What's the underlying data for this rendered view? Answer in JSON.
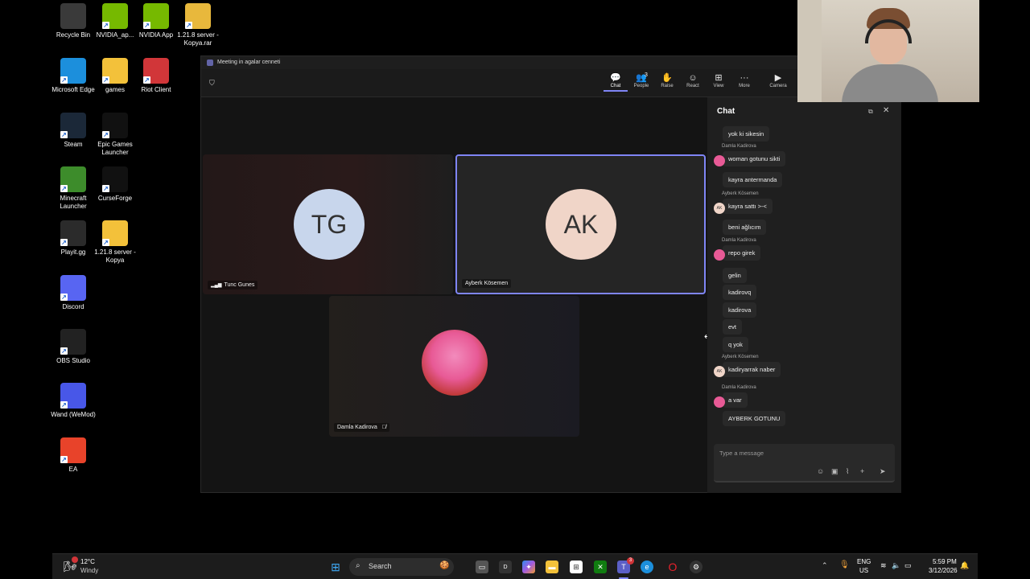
{
  "desktop": {
    "icons": [
      {
        "label": "Recycle Bin",
        "icon": "recycle-bin-icon",
        "color": "#3a3a3a"
      },
      {
        "label": "NVIDIA_ap...",
        "icon": "nvidia-icon",
        "color": "#76b900"
      },
      {
        "label": "NVIDIA App",
        "icon": "nvidia-icon",
        "color": "#76b900"
      },
      {
        "label": "1.21.8 server - Kopya.rar",
        "icon": "archive-icon",
        "color": "#e8b83c"
      },
      {
        "label": "Microsoft Edge",
        "icon": "edge-icon",
        "color": "#1c8fdc"
      },
      {
        "label": "games",
        "icon": "folder-icon",
        "color": "#f3c13a"
      },
      {
        "label": "Riot Client",
        "icon": "riot-icon",
        "color": "#d13639"
      },
      {
        "label": "Steam",
        "icon": "steam-icon",
        "color": "#1b2838"
      },
      {
        "label": "Epic Games Launcher",
        "icon": "epic-games-icon",
        "color": "#111111"
      },
      {
        "label": "Minecraft Launcher",
        "icon": "minecraft-icon",
        "color": "#3d8c2b"
      },
      {
        "label": "CurseForge",
        "icon": "curseforge-icon",
        "color": "#111111"
      },
      {
        "label": "Playit.gg",
        "icon": "playit-icon",
        "color": "#2b2b2b"
      },
      {
        "label": "1.21.8 server - Kopya",
        "icon": "folder-icon",
        "color": "#f3c13a"
      },
      {
        "label": "Discord",
        "icon": "discord-icon",
        "color": "#5865f2"
      },
      {
        "label": "OBS Studio",
        "icon": "obs-icon",
        "color": "#222222"
      },
      {
        "label": "Wand (WeMod)",
        "icon": "wand-icon",
        "color": "#4857e8"
      },
      {
        "label": "EA",
        "icon": "ea-icon",
        "color": "#e8432a"
      }
    ]
  },
  "teams": {
    "window_title": "Meeting in agalar cenneti",
    "toolbar": [
      {
        "label": "Chat",
        "glyph": "💬",
        "icon": "chat-icon",
        "active": true
      },
      {
        "label": "People",
        "glyph": "👥",
        "icon": "people-icon",
        "badge": "3"
      },
      {
        "label": "Raise",
        "glyph": "✋",
        "icon": "raise-hand-icon"
      },
      {
        "label": "React",
        "glyph": "☺",
        "icon": "react-icon"
      },
      {
        "label": "View",
        "glyph": "⊞",
        "icon": "view-icon"
      },
      {
        "label": "More",
        "glyph": "···",
        "icon": "more-icon"
      },
      {
        "label": "Camera",
        "glyph": "▶",
        "icon": "camera-icon"
      }
    ],
    "participants": [
      {
        "initials": "TG",
        "name": "Tunc Gunes",
        "avatar_color": "#c8d6ec"
      },
      {
        "initials": "AK",
        "name": "Ayberk Kösemen",
        "avatar_color": "#f0d5c8"
      },
      {
        "initials": "",
        "name": "Damla Kadirova",
        "avatar_color": "#e85a96"
      }
    ],
    "chat": {
      "title": "Chat",
      "messages": [
        {
          "sender": "",
          "text": "yok ki sikesin"
        },
        {
          "sender": "Damla Kadirova",
          "text": "woman gotunu sikti"
        },
        {
          "sender": "",
          "text": "kayra antermanda"
        },
        {
          "sender": "Ayberk Kösemen",
          "text": "kayra sattı >-<"
        },
        {
          "sender": "",
          "text": "beni ağlıcım"
        },
        {
          "sender": "Damla Kadirova",
          "text": "repo girek"
        },
        {
          "sender": "",
          "text": "gelin"
        },
        {
          "sender": "",
          "text": "kadirovq"
        },
        {
          "sender": "",
          "text": "kadirova"
        },
        {
          "sender": "",
          "text": "evt"
        },
        {
          "sender": "",
          "text": "q yok"
        },
        {
          "sender": "Ayberk Kösemen",
          "text": "kadiryarrak naber"
        },
        {
          "sender": "Damla Kadirova",
          "text": "a var"
        },
        {
          "sender": "",
          "text": "AYBERK GOTUNU"
        }
      ],
      "compose_placeholder": "Type a message"
    }
  },
  "taskbar": {
    "weather_temp": "12°C",
    "weather_desc": "Windy",
    "search_label": "Search",
    "language": "ENG",
    "region": "US",
    "time": "5:59 PM",
    "date": "3/12/2026",
    "teams_badge": "3"
  }
}
